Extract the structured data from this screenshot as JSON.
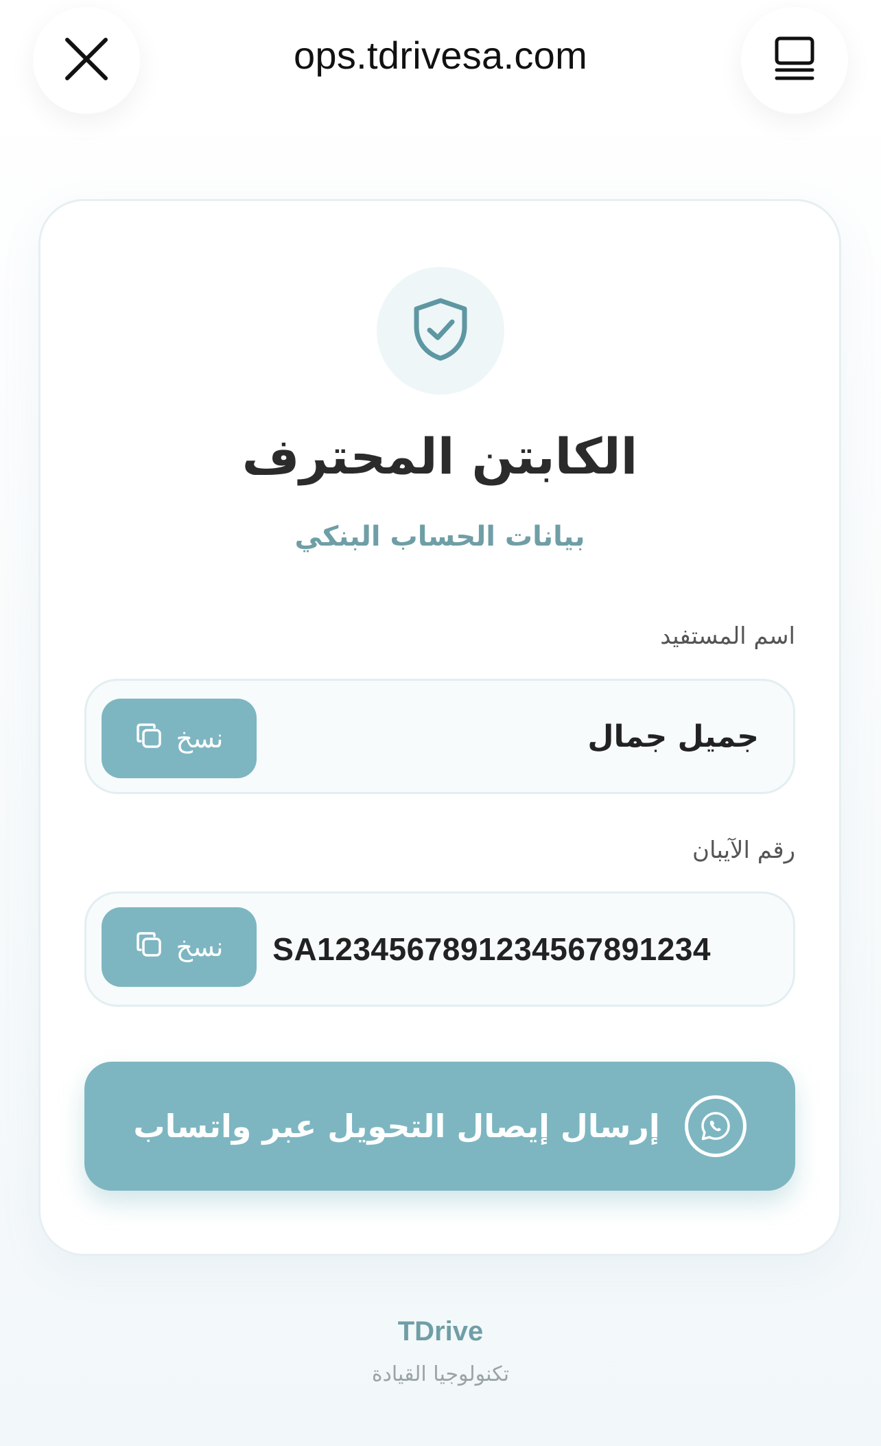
{
  "browser": {
    "url": "ops.tdrivesa.com"
  },
  "card": {
    "title": "الكابتن المحترف",
    "subtitle": "بيانات الحساب البنكي",
    "beneficiary": {
      "label": "اسم المستفيد",
      "value": "جميل جمال",
      "copy_label": "نسخ"
    },
    "iban": {
      "label": "رقم الآيبان",
      "value": "SA1234567891234567891234",
      "copy_label": "نسخ"
    },
    "send_button_label": "إرسال إيصال التحويل عبر واتساب"
  },
  "footer": {
    "brand": "TDrive",
    "tagline": "تكنولوجيا القيادة"
  },
  "icons": {
    "close": "close-icon",
    "reader": "reader-mode-icon",
    "shield": "shield-check-icon",
    "copy": "copy-icon",
    "whatsapp": "whatsapp-icon"
  },
  "colors": {
    "accent": "#7db6c1",
    "accent_text": "#6f9ea6",
    "shield_bg": "#eef6f8"
  }
}
